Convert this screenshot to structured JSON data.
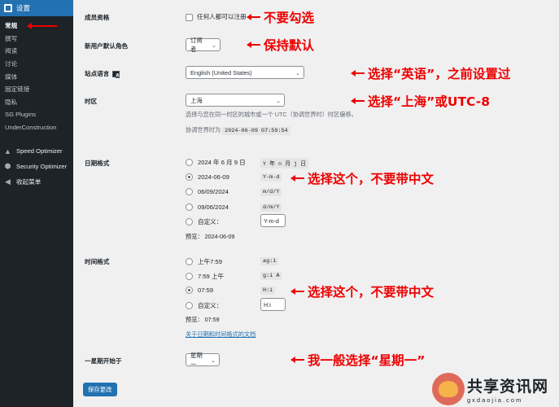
{
  "sidebar": {
    "header": "设置",
    "items": [
      {
        "label": "常规",
        "active": true
      },
      {
        "label": "撰写"
      },
      {
        "label": "阅读"
      },
      {
        "label": "讨论"
      },
      {
        "label": "媒体"
      },
      {
        "label": "固定链接"
      },
      {
        "label": "隐私"
      },
      {
        "label": "SG Plugins"
      },
      {
        "label": "UnderConstruction"
      }
    ],
    "plugins": [
      {
        "label": "Speed Optimizer",
        "icon": "speed-icon"
      },
      {
        "label": "Security Optimizer",
        "icon": "shield-icon"
      },
      {
        "label": "收起菜单",
        "icon": "collapse-icon"
      }
    ]
  },
  "settings": {
    "membership": {
      "label": "成员资格",
      "checkbox_label": "任何人都可以注册"
    },
    "default_role": {
      "label": "新用户默认角色",
      "value": "订阅者"
    },
    "site_language": {
      "label": "站点语言",
      "value": "English (United States)"
    },
    "timezone": {
      "label": "时区",
      "value": "上海",
      "desc": "选择与您在同一时区的城市或一个 UTC（协调世界时）时区偏移。",
      "utc_prefix": "协调世界时为",
      "utc_time": "2024-06-09 07:59:54"
    },
    "date_format": {
      "label": "日期格式",
      "options": [
        {
          "text": "2024 年 6 月 9 日",
          "code": "Y 年 n 月 j 日",
          "checked": false
        },
        {
          "text": "2024-06-09",
          "code": "Y-m-d",
          "checked": true
        },
        {
          "text": "06/09/2024",
          "code": "m/d/Y",
          "checked": false
        },
        {
          "text": "09/06/2024",
          "code": "d/m/Y",
          "checked": false
        }
      ],
      "custom_label": "自定义：",
      "custom_value": "Y-m-d",
      "preview_label": "预览：",
      "preview_value": "2024-06-09"
    },
    "time_format": {
      "label": "时间格式",
      "options": [
        {
          "text": "上午7:59",
          "code": "ag:i",
          "checked": false
        },
        {
          "text": "7:59 上午",
          "code": "g:i A",
          "checked": false
        },
        {
          "text": "07:59",
          "code": "H:i",
          "checked": true
        }
      ],
      "custom_label": "自定义：",
      "custom_value": "H:i",
      "preview_label": "预览：",
      "preview_value": "07:59",
      "doc_link": "关于日期和时间格式的文档"
    },
    "week_start": {
      "label": "一星期开始于",
      "value": "星期一"
    },
    "save": "保存更改"
  },
  "annotations": {
    "a1": "不要勾选",
    "a2": "保持默认",
    "a3": "选择“英语”，之前设置过",
    "a4": "选择“上海”或UTC-8",
    "a5": "选择这个，不要带中文",
    "a6": "选择这个，不要带中文",
    "a7": "我一般选择“星期一”"
  },
  "watermark": {
    "title": "共享资讯网",
    "url": "gxdaojia.com"
  },
  "colors": {
    "accent": "#2271b1",
    "sidebar_bg": "#1d2327",
    "annotation": "#e00000"
  }
}
